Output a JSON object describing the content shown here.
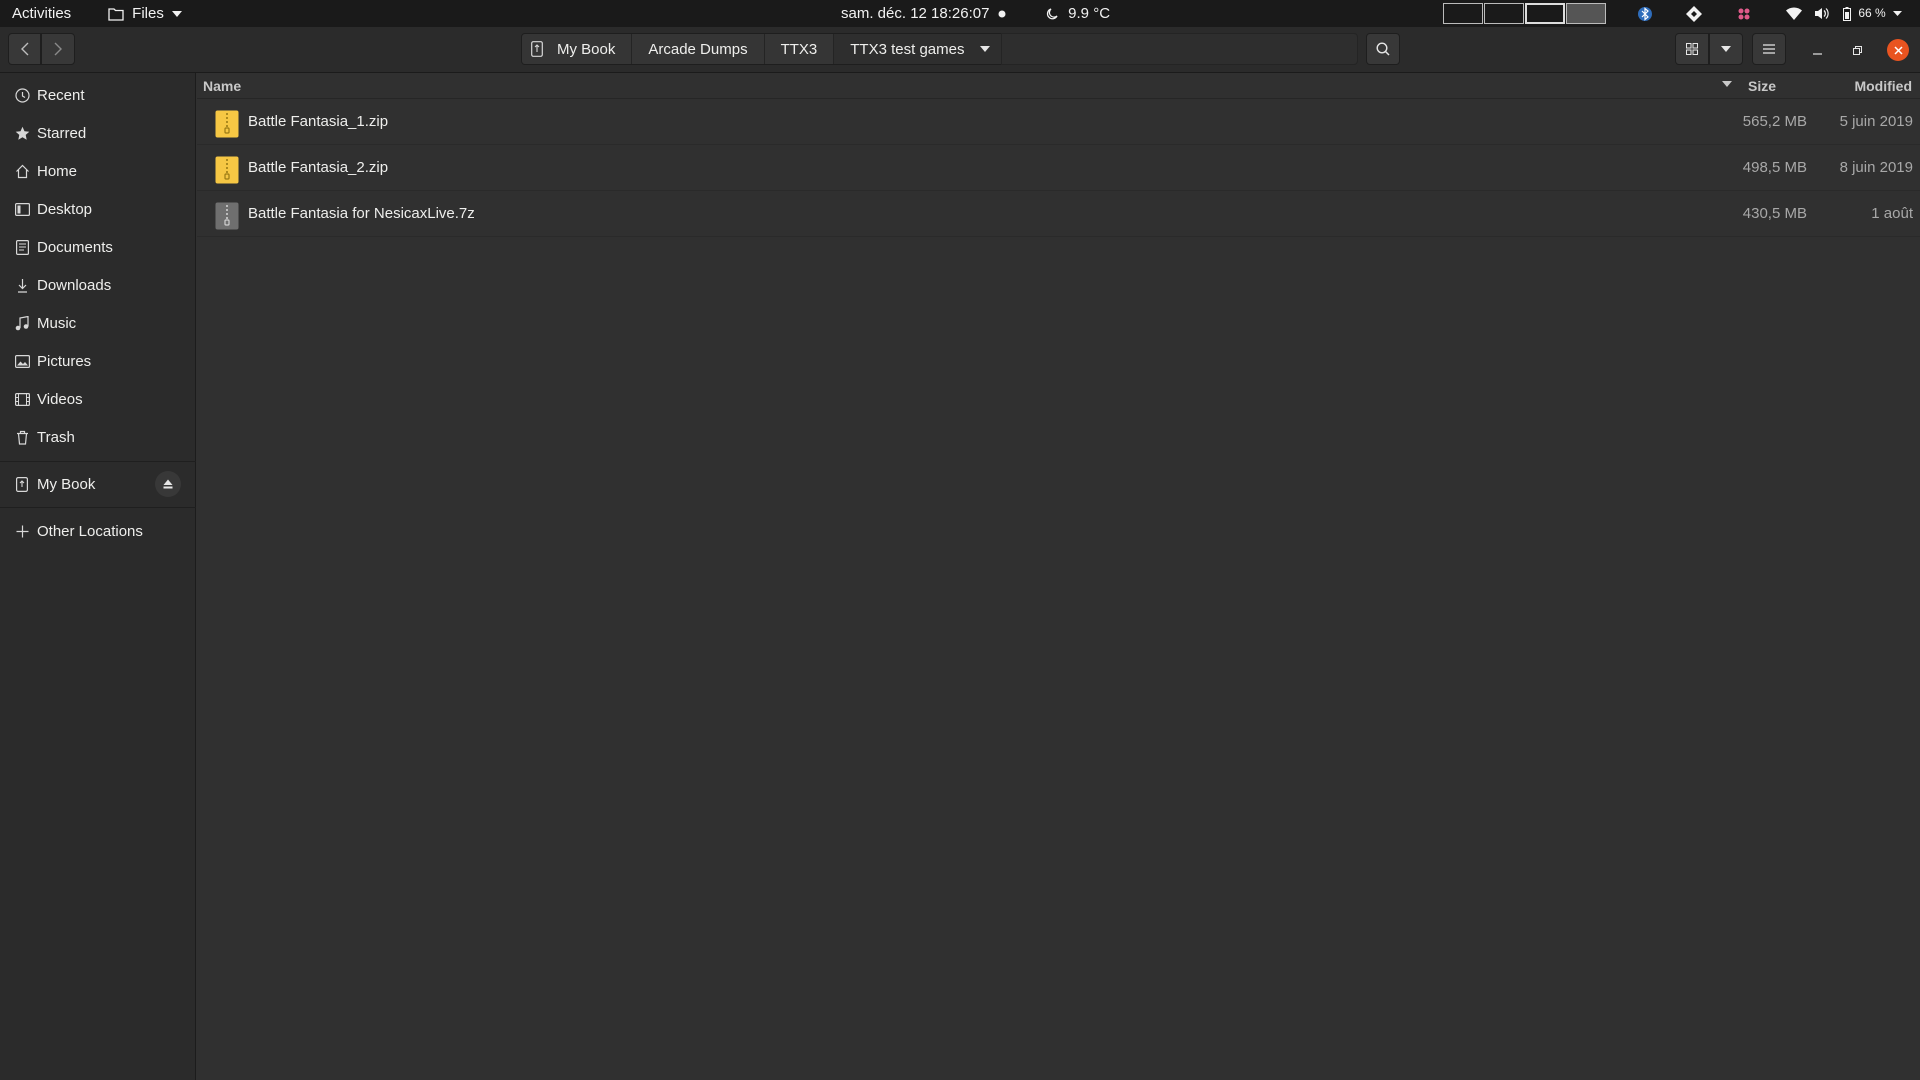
{
  "topbar": {
    "activities": "Activities",
    "app_menu": "Files",
    "clock": "sam. déc. 12  18:26:07",
    "weather": "9.9 °C",
    "battery": "66 %"
  },
  "header": {
    "breadcrumbs": [
      "My Book",
      "Arcade Dumps",
      "TTX3",
      "TTX3 test games"
    ]
  },
  "sidebar": {
    "items": [
      {
        "label": "Recent",
        "icon": "clock-icon"
      },
      {
        "label": "Starred",
        "icon": "star-icon"
      },
      {
        "label": "Home",
        "icon": "home-icon"
      },
      {
        "label": "Desktop",
        "icon": "desktop-icon"
      },
      {
        "label": "Documents",
        "icon": "document-icon"
      },
      {
        "label": "Downloads",
        "icon": "download-icon"
      },
      {
        "label": "Music",
        "icon": "music-icon"
      },
      {
        "label": "Pictures",
        "icon": "picture-icon"
      },
      {
        "label": "Videos",
        "icon": "video-icon"
      },
      {
        "label": "Trash",
        "icon": "trash-icon"
      }
    ],
    "drive": {
      "label": "My Book",
      "icon": "usb-drive-icon"
    },
    "other": {
      "label": "Other Locations",
      "icon": "plus-icon"
    }
  },
  "columns": {
    "name": "Name",
    "size": "Size",
    "modified": "Modified"
  },
  "files": [
    {
      "name": "Battle Fantasia_1.zip",
      "size": "565,2 MB",
      "modified": "5 juin 2019",
      "icon": "zip-archive-icon",
      "color": "#f6c744"
    },
    {
      "name": "Battle Fantasia_2.zip",
      "size": "498,5 MB",
      "modified": "8 juin 2019",
      "icon": "zip-archive-icon",
      "color": "#f6c744"
    },
    {
      "name": "Battle Fantasia for NesicaxLive.7z",
      "size": "430,5 MB",
      "modified": "1 août",
      "icon": "7z-archive-icon",
      "color": "#7a7a7a"
    }
  ],
  "colors": {
    "accent_close": "#e95420",
    "window_bg": "#303030",
    "sidebar_bg": "#2b2b2b"
  }
}
